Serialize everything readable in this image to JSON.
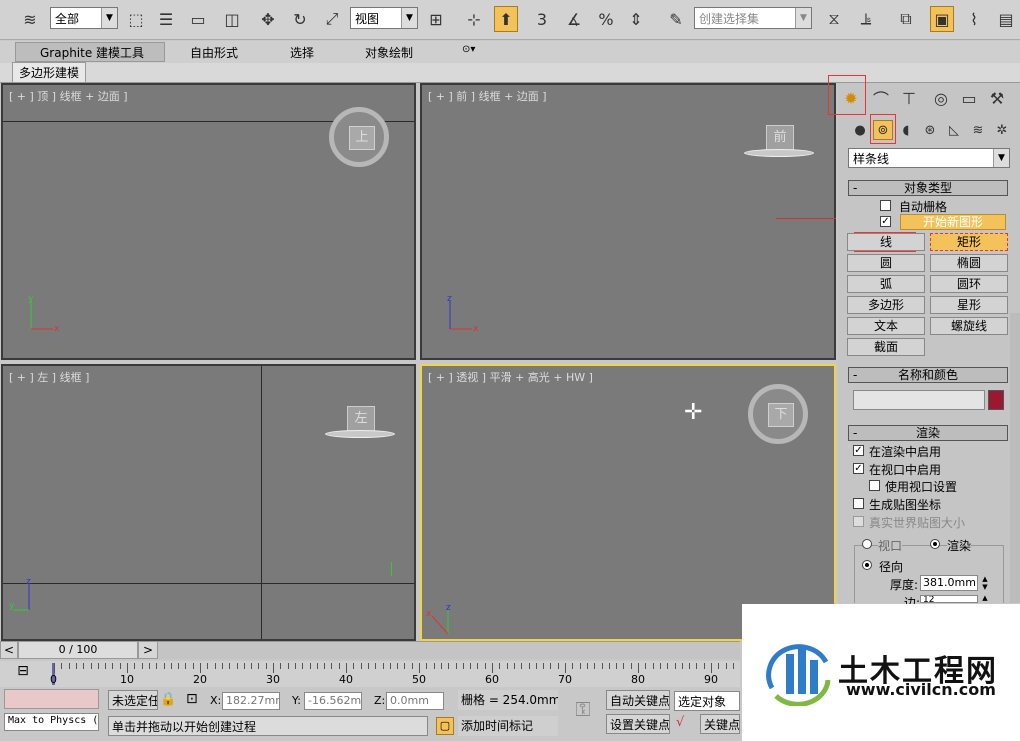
{
  "toolbar": {
    "selection_filter": "全部",
    "ref_coord": "视图",
    "percent_snap_label": "%",
    "angle_snap_label": "3",
    "named_selection_placeholder": "创建选择集",
    "icons": [
      "undo-icon",
      "select-icon",
      "select-by-name-icon",
      "rect-region-icon",
      "window-crossing-icon",
      "move-icon",
      "rotate-icon",
      "scale-icon",
      "pivot-icon",
      "snap-toggle-icon",
      "angle-snap-icon",
      "percent-snap-icon",
      "spinner-snap-icon",
      "edit-named-sel-icon",
      "mirror-icon",
      "align-icon",
      "layer-manager-icon",
      "graphite-toggle-icon",
      "curve-editor-icon",
      "schematic-icon"
    ]
  },
  "ribbon": {
    "tabs": [
      "Graphite 建模工具",
      "自由形式",
      "选择",
      "对象绘制"
    ],
    "subtab": "多边形建模"
  },
  "viewports": {
    "top": {
      "label": "[ + ] 顶 ] 线框 + 边面 ]",
      "cube_face": "上"
    },
    "front": {
      "label": "[ + ] 前 ] 线框 + 边面 ]",
      "cube_face": "前"
    },
    "left": {
      "label": "[ + ] 左 ] 线框 ]",
      "cube_face": "左"
    },
    "perspective": {
      "label": "[ + ] 透视 ] 平滑 + 高光 + HW ]",
      "cube_face": "下"
    },
    "axis_x": "x",
    "axis_y": "y",
    "axis_z": "z"
  },
  "command_panel": {
    "category_dropdown": "样条线",
    "object_type": {
      "title": "对象类型",
      "auto_grid": "自动栅格",
      "start_new_shape": "开始新图形",
      "buttons": [
        "线",
        "矩形",
        "圆",
        "椭圆",
        "弧",
        "圆环",
        "多边形",
        "星形",
        "文本",
        "螺旋线",
        "截面"
      ]
    },
    "name_color": {
      "title": "名称和颜色",
      "name_value": "",
      "swatch_color": "#9b1832"
    },
    "rendering": {
      "title": "渲染",
      "enable_in_renderer": "在渲染中启用",
      "enable_in_viewport": "在视口中启用",
      "use_viewport_settings": "使用视口设置",
      "gen_mapping": "生成贴图坐标",
      "real_world_map": "真实世界贴图大小",
      "viewport_radio": "视口",
      "render_radio": "渲染",
      "radial": "径向",
      "thickness_label": "厚度:",
      "thickness_value": "381.0mm",
      "sides_label": "边:",
      "sides_value": "12"
    }
  },
  "timeline": {
    "frame": "0 / 100",
    "prev": "<",
    "next": ">"
  },
  "ruler": {
    "ticks": [
      "0",
      "10",
      "20",
      "30",
      "40",
      "50",
      "60",
      "70",
      "80",
      "90"
    ]
  },
  "status": {
    "maxscript": "Max to Physcs (",
    "selection_status": "未选定任",
    "prompt": "单击并拖动以开始创建过程",
    "x_label": "X:",
    "x_value": "182.27mm",
    "y_label": "Y:",
    "y_value": "-16.562mm",
    "z_label": "Z:",
    "z_value": "0.0mm",
    "grid": "栅格 = 254.0mm",
    "add_time_tag": "添加时间标记",
    "auto_key": "自动关键点",
    "set_key": "设置关键点",
    "selected_object": "选定对象",
    "key_filter": "关键点过"
  },
  "watermark": {
    "title": "土木工程网",
    "url": "www.civilcn.com"
  }
}
